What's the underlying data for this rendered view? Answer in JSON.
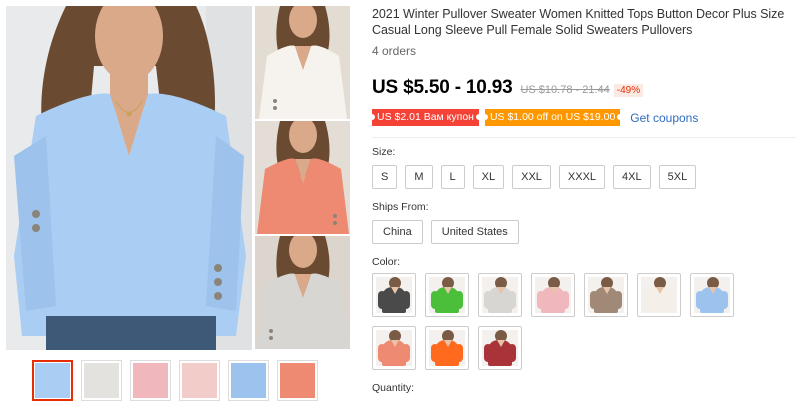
{
  "product": {
    "title": "2021 Winter Pullover Sweater Women Knitted Tops Button Decor Plus Size Casual Long Sleeve Pull Female Solid Sweaters Pullovers",
    "orders": "4 orders"
  },
  "pricing": {
    "price": "US $5.50 - 10.93",
    "old_price": "US $10.78 - 21.44",
    "discount": "-49%"
  },
  "coupons": {
    "coupon1": "US $2.01 Вам купон",
    "coupon2": "US $1.00 off on US $19.00",
    "get_coupons": "Get coupons"
  },
  "size": {
    "label": "Size:",
    "options": [
      "S",
      "M",
      "L",
      "XL",
      "XXL",
      "XXXL",
      "4XL",
      "5XL"
    ]
  },
  "ships_from": {
    "label": "Ships From:",
    "options": [
      "China",
      "United States"
    ]
  },
  "color": {
    "label": "Color:",
    "swatches": [
      "#4a4a4a",
      "#4cbf3a",
      "#d8d6d2",
      "#f0b7bd",
      "#a08a77",
      "#f4efe9",
      "#9cc3ee",
      "#ee8a72",
      "#ff6a1f",
      "#a8343a"
    ]
  },
  "quantity": {
    "label": "Quantity:"
  },
  "colors": {
    "accent": "#e62e04",
    "link": "#2e6cc0",
    "main_sweater": "#a9cdf3"
  }
}
